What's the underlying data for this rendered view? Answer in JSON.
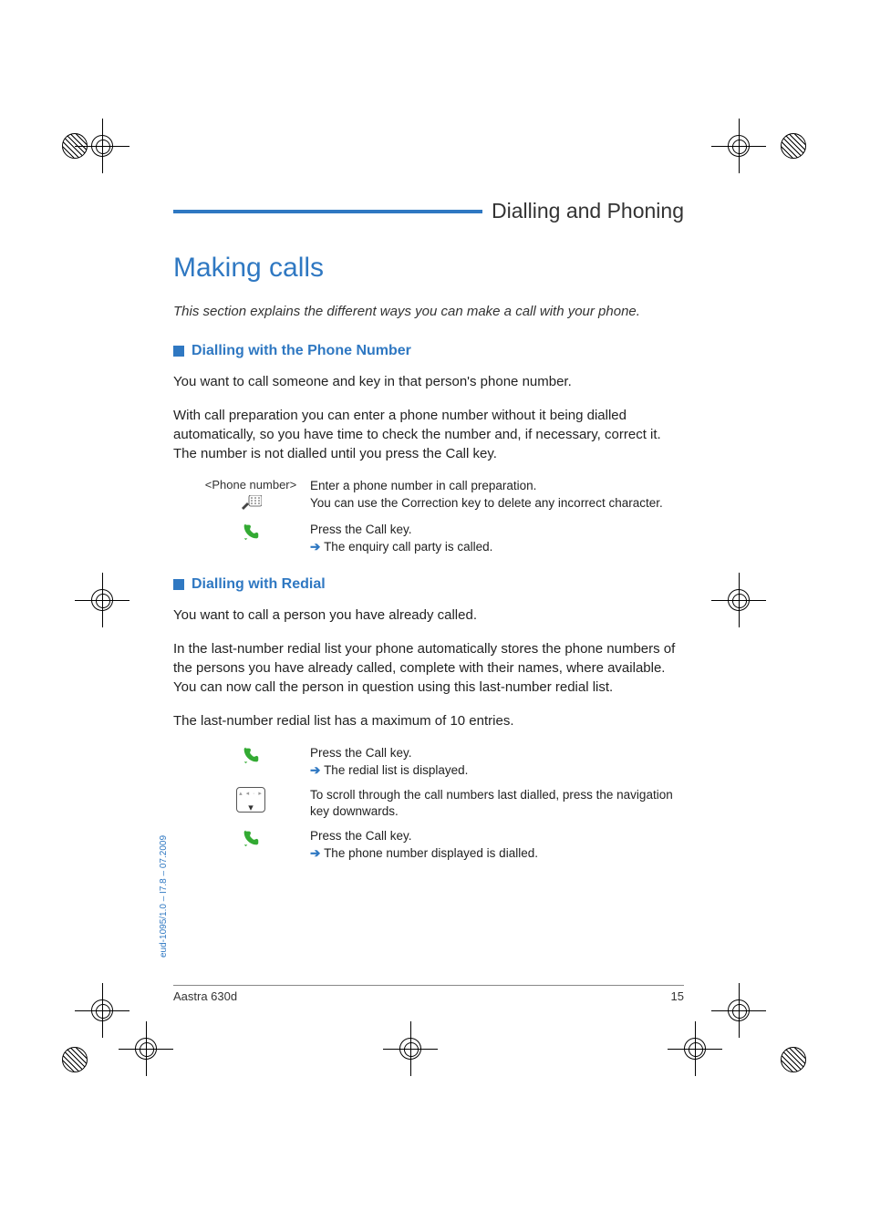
{
  "header": {
    "section_title": "Dialling and Phoning"
  },
  "main": {
    "heading": "Making calls",
    "intro": "This section explains the different ways you can make a call with your phone.",
    "sections": [
      {
        "title": "Dialling with the Phone Number",
        "paras": [
          "You want to call someone and key in that person's phone number.",
          "With call preparation you can enter a phone number without it being dialled automatically, so you have time to check the number and, if necessary, correct it. The number is not dialled until you press the Call key."
        ],
        "steps": [
          {
            "label": "<Phone number>",
            "icon": "keypad-icon",
            "line1": "Enter a phone number in call preparation.",
            "line2": "You can use the Correction key to delete any incorrect character."
          },
          {
            "label": "",
            "icon": "call-key-icon",
            "line1": "Press the Call key.",
            "result": "The enquiry call party is called."
          }
        ]
      },
      {
        "title": "Dialling with Redial",
        "paras": [
          "You want to call a person you have already called.",
          "In the last-number redial list your phone automatically stores the phone numbers of the persons you have already called, complete with their names, where available. You can now call the person in question using this last-number redial list.",
          "The last-number redial list has a maximum of 10 entries."
        ],
        "steps": [
          {
            "label": "",
            "icon": "call-key-icon",
            "line1": "Press the Call key.",
            "result": "The redial list is displayed."
          },
          {
            "label": "",
            "icon": "nav-key-icon",
            "line1": "To scroll through the call numbers last dialled, press the navigation key downwards."
          },
          {
            "label": "",
            "icon": "call-key-icon",
            "line1": "Press the Call key.",
            "result": "The phone number displayed is dialled."
          }
        ]
      }
    ]
  },
  "footer": {
    "product": "Aastra 630d",
    "page": "15",
    "side_label": "eud-1095/1.0 – I7.8 – 07.2009"
  }
}
